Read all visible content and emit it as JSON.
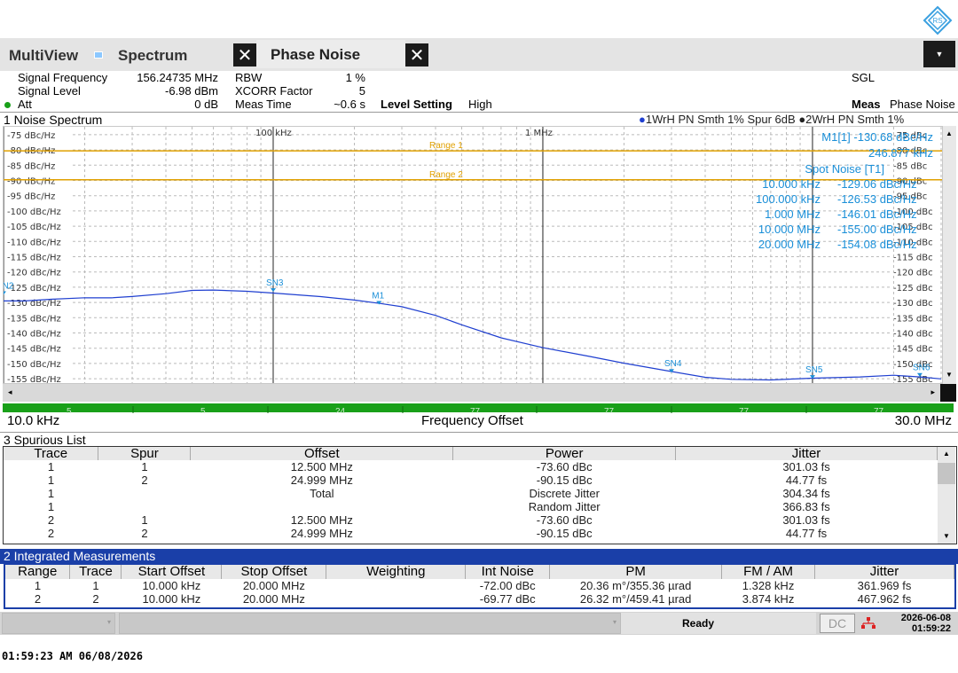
{
  "header": {
    "tab_multiview": "MultiView",
    "tab_spectrum": "Spectrum",
    "tab_phase_noise": "Phase Noise"
  },
  "settings": {
    "signal_frequency_label": "Signal Frequency",
    "signal_frequency_value": "156.24735 MHz",
    "signal_level_label": "Signal Level",
    "signal_level_value": "-6.98 dBm",
    "att_label": "Att",
    "att_value": "0 dB",
    "rbw_label": "RBW",
    "rbw_value": "1 %",
    "xcorr_label": "XCORR Factor",
    "xcorr_value": "5",
    "meas_time_label": "Meas Time",
    "meas_time_value": "~0.6 s",
    "level_setting_label": "Level Setting",
    "level_setting_value": "High",
    "sgl": "SGL",
    "meas_label": "Meas",
    "meas_value": "Phase Noise"
  },
  "noise_spectrum": {
    "title": "1 Noise Spectrum",
    "trace1_legend": "1WrH PN Smth 1% Spur 6dB",
    "trace2_legend": "2WrH PN Smth 1%",
    "y_labels": [
      "-75 dBc/Hz",
      "-80 dBc/Hz",
      "-85 dBc/Hz",
      "-90 dBc/Hz",
      "-95 dBc/Hz",
      "-100 dBc/Hz",
      "-105 dBc/Hz",
      "-110 dBc/Hz",
      "-115 dBc/Hz",
      "-120 dBc/Hz",
      "-125 dBc/Hz",
      "-130 dBc/Hz",
      "-135 dBc/Hz",
      "-140 dBc/Hz",
      "-145 dBc/Hz",
      "-150 dBc/Hz",
      "-155 dBc/Hz"
    ],
    "y_labels_right": [
      "-75 dBc",
      "-80 dBc",
      "-85 dBc",
      "-90 dBc",
      "-95 dBc",
      "-100 dBc",
      "-105 dBc",
      "-110 dBc",
      "-115 dBc",
      "-120 dBc",
      "-125 dBc",
      "-130 dBc",
      "-135 dBc",
      "-140 dBc",
      "-145 dBc",
      "-150 dBc",
      "-155 dBc"
    ],
    "x_tick_100k": "100 kHz",
    "x_tick_1m": "1 MHz",
    "range1": "Range 1",
    "range2": "Range 2",
    "marker_m1_readout": "M1[1] -130.68 dBc/Hz",
    "marker_m1_freq": "246.877 kHz",
    "spot_noise_title": "Spot Noise [T1]",
    "spot_noise": [
      {
        "freq": "10.000 kHz",
        "value": "-129.06 dBc/Hz"
      },
      {
        "freq": "100.000 kHz",
        "value": "-126.53 dBc/Hz"
      },
      {
        "freq": "1.000 MHz",
        "value": "-146.01 dBc/Hz"
      },
      {
        "freq": "10.000 MHz",
        "value": "-155.00 dBc/Hz"
      },
      {
        "freq": "20.000 MHz",
        "value": "-154.08 dBc/Hz"
      }
    ],
    "marker_labels": [
      "SN2",
      "SN3",
      "M1",
      "SN4",
      "SN5",
      "SN6"
    ],
    "segment_counts": [
      "5",
      "5",
      "24",
      "77",
      "77",
      "77",
      "77"
    ],
    "x_start": "10.0 kHz",
    "x_center_label": "Frequency Offset",
    "x_stop": "30.0 MHz"
  },
  "chart_data": {
    "type": "line",
    "xscale": "log",
    "xlim": [
      10000,
      30000000
    ],
    "ylim": [
      -157,
      -73
    ],
    "xlabel": "Frequency Offset",
    "ylabel": "",
    "series": [
      {
        "x": [
          10000,
          12000,
          15000,
          20000,
          25000,
          30000,
          40000,
          50000,
          60000,
          80000,
          100000,
          150000,
          200000,
          250000,
          300000,
          400000,
          500000,
          700000,
          1000000,
          1500000,
          2000000,
          3000000,
          4000000,
          5000000,
          7000000,
          10000000,
          15000000,
          20000000,
          25000000,
          30000000
        ],
        "y": [
          -129.5,
          -130,
          -129.5,
          -128.5,
          -128,
          -127.5,
          -127,
          -126.5,
          -126.5,
          -126.5,
          -126.5,
          -127.5,
          -129,
          -130.7,
          -132,
          -134.5,
          -137,
          -141,
          -144.5,
          -148,
          -150.5,
          -153,
          -154.3,
          -154.6,
          -155,
          -155.0,
          -155,
          -154.3,
          -154.3,
          -154.5
        ]
      }
    ]
  },
  "spurious_list": {
    "title": "3 Spurious List",
    "columns": [
      "Trace",
      "Spur",
      "Offset",
      "Power",
      "Jitter"
    ],
    "rows": [
      [
        "1",
        "1",
        "12.500 MHz",
        "-73.60 dBc",
        "301.03 fs"
      ],
      [
        "1",
        "2",
        "24.999 MHz",
        "-90.15 dBc",
        "44.77 fs"
      ],
      [
        "1",
        "",
        "Total",
        "Discrete Jitter",
        "304.34 fs"
      ],
      [
        "1",
        "",
        "",
        "Random Jitter",
        "366.83 fs"
      ],
      [
        "2",
        "1",
        "12.500 MHz",
        "-73.60 dBc",
        "301.03 fs"
      ],
      [
        "2",
        "2",
        "24.999 MHz",
        "-90.15 dBc",
        "44.77 fs"
      ]
    ]
  },
  "integrated": {
    "title": "2 Integrated Measurements",
    "columns": [
      "Range",
      "Trace",
      "Start Offset",
      "Stop Offset",
      "Weighting",
      "Int Noise",
      "PM",
      "FM / AM",
      "Jitter"
    ],
    "rows": [
      [
        "1",
        "1",
        "10.000 kHz",
        "20.000 MHz",
        "",
        "-72.00 dBc",
        "20.36 m°/355.36 µrad",
        "1.328 kHz",
        "361.969 fs"
      ],
      [
        "2",
        "2",
        "10.000 kHz",
        "20.000 MHz",
        "",
        "-69.77 dBc",
        "26.32 m°/459.41 µrad",
        "3.874 kHz",
        "467.962 fs"
      ]
    ]
  },
  "status": {
    "ready": "Ready",
    "dc": "DC",
    "date": "2026-06-08",
    "time": "01:59:22"
  },
  "footer": {
    "timestamp": "01:59:23 AM  06/08/2026"
  },
  "colors": {
    "trace": "#1f3fd0",
    "marker_text": "#1a8fd8",
    "range_line": "#e0a000",
    "accent_blue": "#1a3fa8",
    "green_bar": "#19a019"
  }
}
